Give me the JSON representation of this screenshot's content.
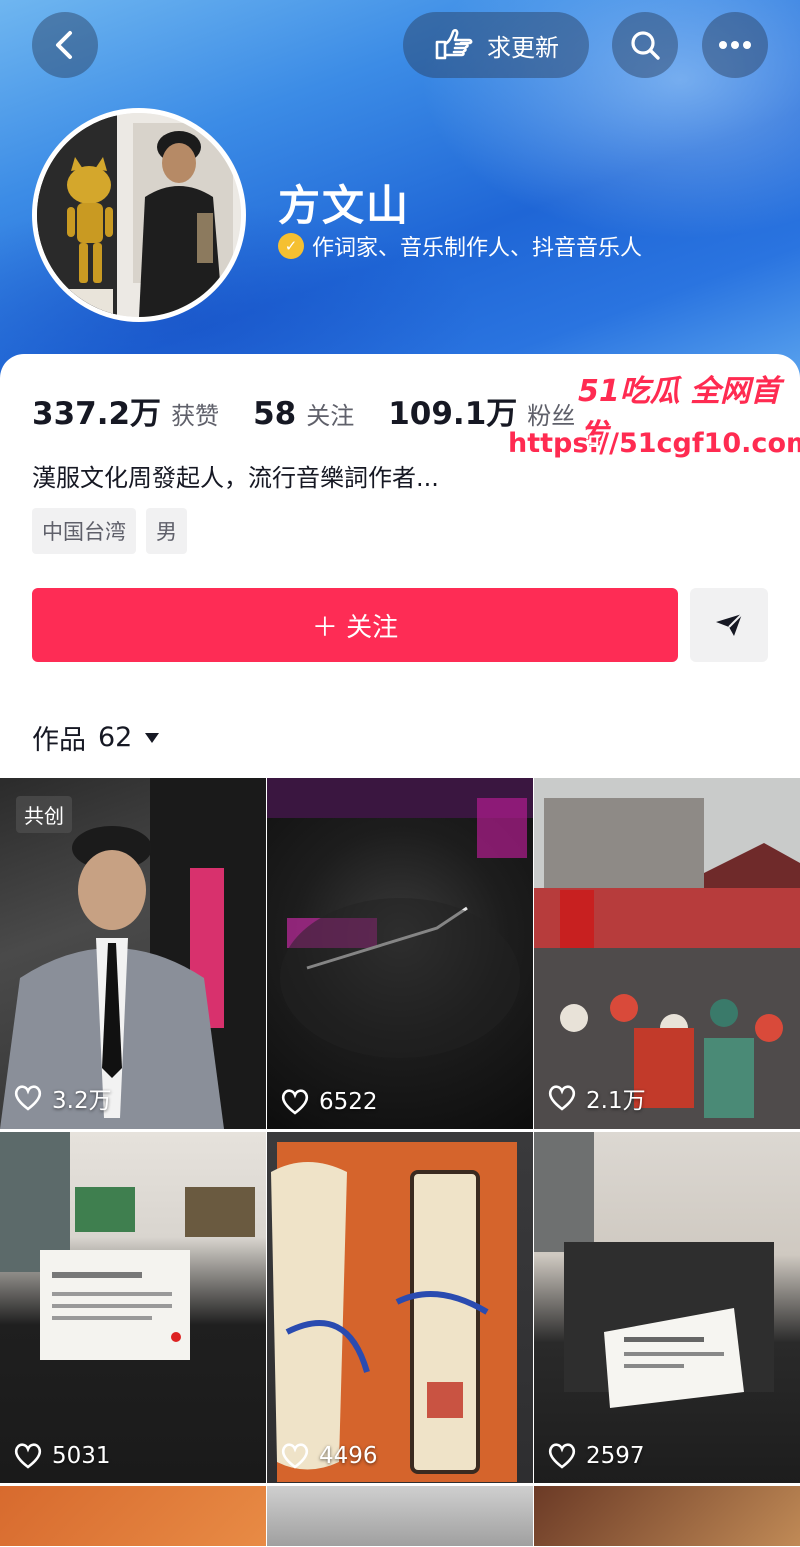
{
  "header": {
    "back_icon": "chevron-left-icon",
    "update_button": {
      "label": "求更新",
      "icon": "pointing-hand-icon"
    },
    "search_icon": "search-icon",
    "more_icon": "more-icon",
    "username": "方文山",
    "verified_text": "作词家、音乐制作人、抖音音乐人"
  },
  "stats": [
    {
      "value": "337.2万",
      "label": "获赞"
    },
    {
      "value": "58",
      "label": "关注"
    },
    {
      "value": "109.1万",
      "label": "粉丝"
    }
  ],
  "bio": "漢服文化周發起人，流行音樂詞作者...",
  "tags": [
    "中国台湾",
    "男"
  ],
  "follow_button": "＋ 关注",
  "works_tab": {
    "label": "作品",
    "count": "62"
  },
  "watermark": {
    "title": "51吃瓜 全网首发",
    "url": "https://51cgf10.com"
  },
  "videos": [
    {
      "likes": "3.2万",
      "badge": "共创"
    },
    {
      "likes": "6522"
    },
    {
      "likes": "2.1万"
    },
    {
      "likes": "5031"
    },
    {
      "likes": "4496"
    },
    {
      "likes": "2597"
    }
  ],
  "colors": {
    "brand": "#fe2c55",
    "verify": "#f5c031",
    "header_blue": "#2a74e0"
  }
}
